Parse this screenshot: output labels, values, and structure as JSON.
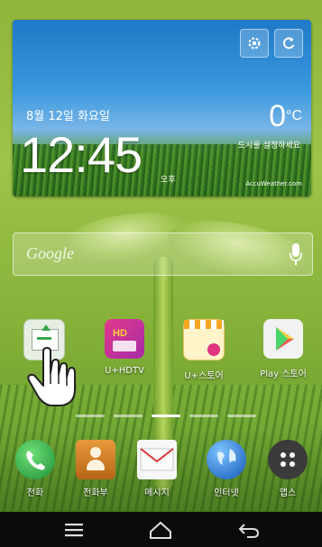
{
  "weather": {
    "date": "8월 12일 화요일",
    "time": "12:45",
    "ampm": "오후",
    "temperature": "0",
    "unit": "°C",
    "location": "도시를 설정하세요",
    "brand": "AccuWeather.com",
    "settings_icon": "settings-icon",
    "refresh_icon": "refresh-icon"
  },
  "search": {
    "logo": "Google",
    "mic_icon": "mic-icon"
  },
  "apps": [
    {
      "label": "",
      "icon": "download-icon"
    },
    {
      "label": "U+HDTV",
      "icon": "uplus-hdtv-icon"
    },
    {
      "label": "U+스토어",
      "icon": "uplus-store-icon"
    },
    {
      "label": "Play 스토어",
      "icon": "play-store-icon"
    }
  ],
  "dock": [
    {
      "label": "전화",
      "icon": "phone-icon"
    },
    {
      "label": "전화부",
      "icon": "contacts-icon"
    },
    {
      "label": "메시지",
      "icon": "message-icon"
    },
    {
      "label": "인터넷",
      "icon": "internet-icon"
    },
    {
      "label": "앱스",
      "icon": "apps-icon"
    }
  ],
  "pages": {
    "count": 5,
    "current": 3
  },
  "nav": {
    "menu_icon": "menu-icon",
    "home_icon": "home-icon",
    "back_icon": "back-icon"
  },
  "colors": {
    "wallpaper": "#8fb53a",
    "nav_bar": "#0b0b0b",
    "sky": "#1f79c7"
  }
}
